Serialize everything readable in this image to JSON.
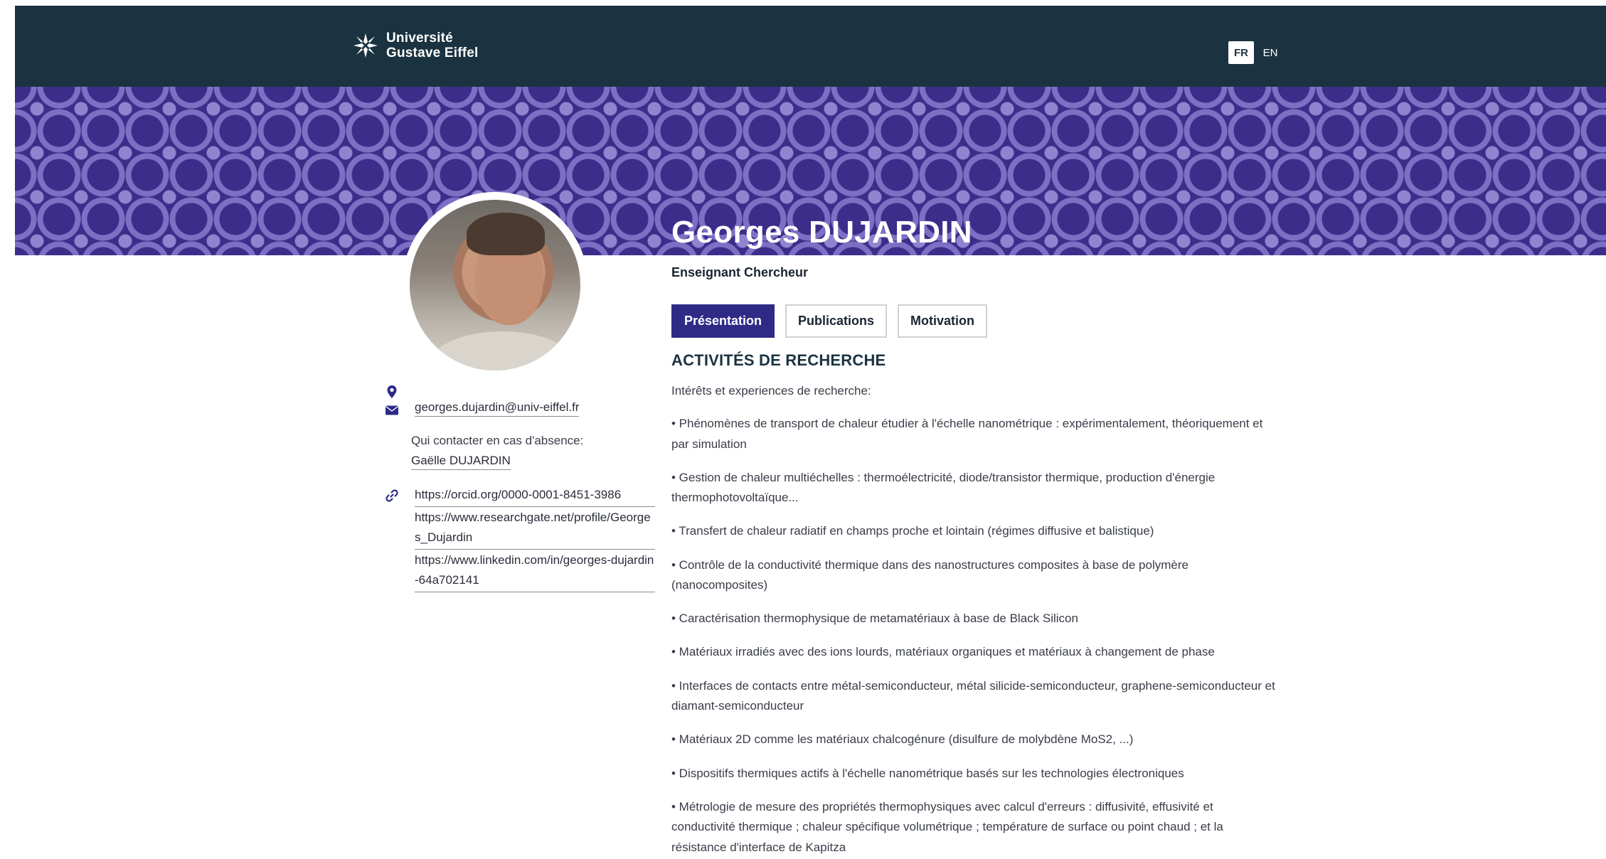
{
  "header": {
    "logo": {
      "icon": "star-emblem-icon",
      "line1": "Université",
      "line2": "Gustave Eiffel"
    },
    "languages": [
      {
        "label": "FR",
        "active": true
      },
      {
        "label": "EN",
        "active": false
      }
    ]
  },
  "profile": {
    "name": "Georges DUJARDIN",
    "role": "Enseignant Chercheur",
    "tabs": [
      {
        "label": "Présentation",
        "active": true
      },
      {
        "label": "Publications",
        "active": false
      },
      {
        "label": "Motivation",
        "active": false
      }
    ]
  },
  "contact": {
    "location_icon": "map-pin-icon",
    "email_icon": "envelope-icon",
    "link_icon": "link-icon",
    "email": "georges.dujardin@univ-eiffel.fr",
    "absence_label": "Qui contacter en cas d'absence:",
    "absence_name": "Gaëlle DUJARDIN",
    "links": [
      "https://orcid.org/0000-0001-8451-3986",
      "https://www.researchgate.net/profile/Georges_Dujardin",
      "https://www.linkedin.com/in/georges-dujardin-64a702141"
    ]
  },
  "research": {
    "title": "ACTIVITÉS DE RECHERCHE",
    "intro": "Intérêts et experiences de recherche:",
    "items": [
      "• Phénomènes de transport de chaleur étudier à l'échelle nanométrique : expérimentalement, théoriquement et par simulation",
      "• Gestion de chaleur multiéchelles : thermoélectricité, diode/transistor thermique, production d'énergie thermophotovoltaïque...",
      "• Transfert de chaleur radiatif en champs proche et lointain (régimes diffusive et balistique)",
      "• Contrôle de la conductivité thermique dans des nanostructures composites à base de polymère (nanocomposites)",
      "• Caractérisation thermophysique de metamatériaux à base de Black Silicon",
      "• Matériaux irradiés avec des ions lourds, matériaux organiques et matériaux à changement de phase",
      "• Interfaces de contacts entre métal-semiconducteur, métal silicide-semiconducteur, graphene-semiconducteur et diamant-semiconducteur",
      "• Matériaux 2D comme les matériaux chalcogénure (disulfure de molybdène MoS2, ...)",
      "• Dispositifs thermiques actifs à l'échelle nanométrique basés sur les technologies électroniques",
      "• Métrologie de mesure des propriétés thermophysiques avec calcul d'erreurs : diffusivité, effusivité et conductivité thermique ; chaleur spécifique volumétrique ; température de surface ou point chaud ; et la résistance d'interface de Kapitza"
    ]
  },
  "colors": {
    "header_bg": "#1b3340",
    "banner_bg": "#3c2d8a",
    "accent": "#2e2a86"
  }
}
